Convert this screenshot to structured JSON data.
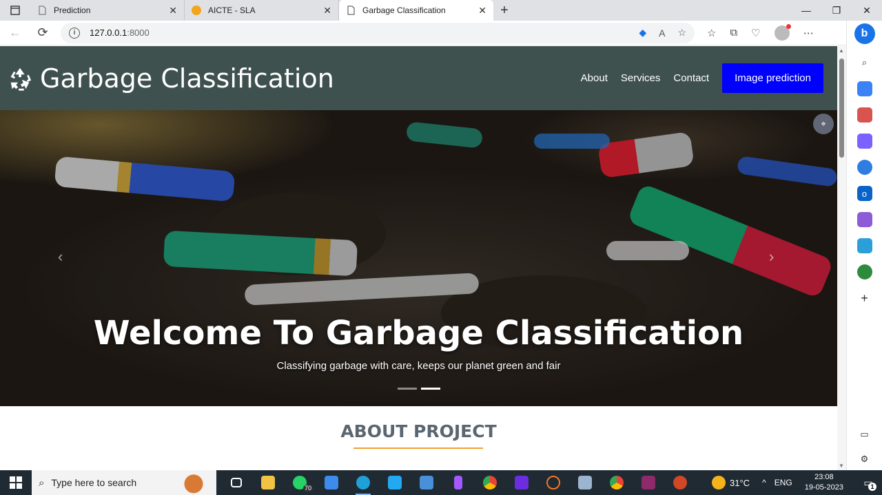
{
  "browser": {
    "tabs": [
      {
        "title": "Prediction",
        "active": false
      },
      {
        "title": "AICTE - SLA",
        "active": false
      },
      {
        "title": "Garbage Classification",
        "active": true
      }
    ],
    "url_host": "127.0.0.1",
    "url_port": ":8000"
  },
  "site": {
    "brand": "Garbage Classification",
    "nav": [
      "About",
      "Services",
      "Contact"
    ],
    "cta": "Image prediction",
    "hero_title": "Welcome To Garbage Classification",
    "hero_subtitle": "Classifying garbage with care, keeps our planet green and fair",
    "about_heading": "ABOUT PROJECT",
    "carousel_slides": 2,
    "carousel_active": 2
  },
  "taskbar": {
    "search_placeholder": "Type here to search",
    "whatsapp_badge": "70",
    "temperature": "31°C",
    "language": "ENG",
    "time": "23:08",
    "date": "19-05-2023",
    "notification_count": "1"
  },
  "colors": {
    "site_nav": "#3f514e",
    "cta": "#0000ff",
    "accent_underline": "#f0a030"
  }
}
